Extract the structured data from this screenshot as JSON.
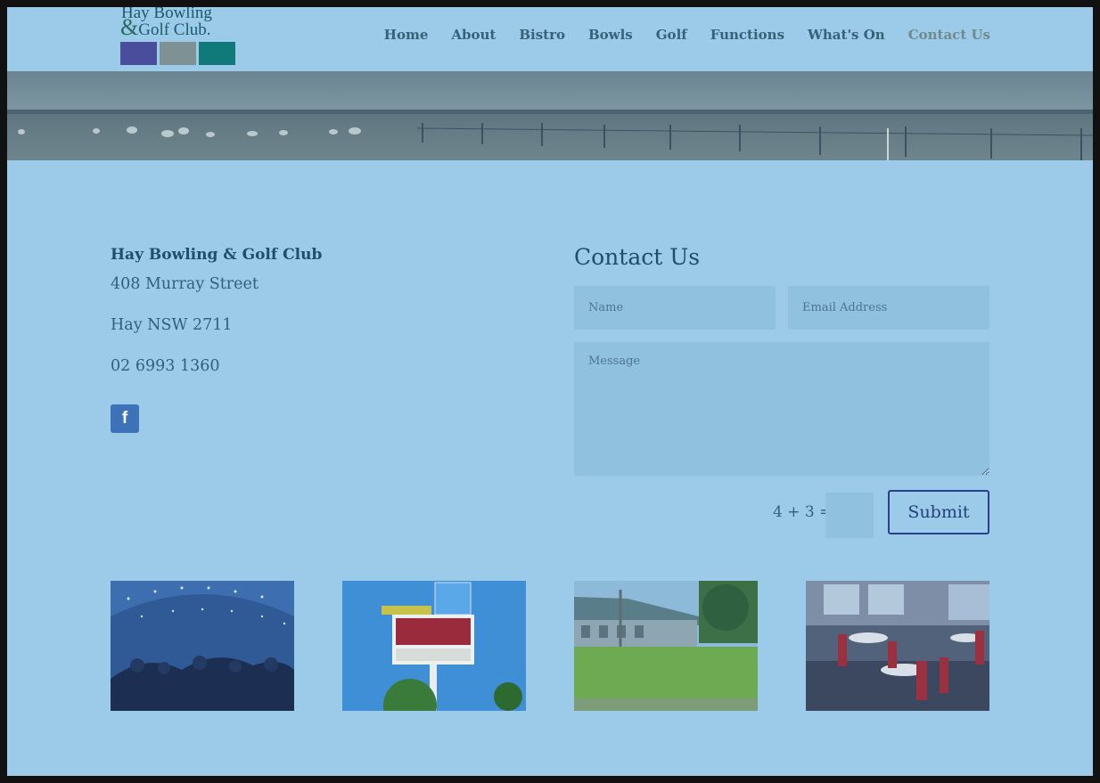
{
  "header": {
    "logo_line1": "Hay Bowling",
    "logo_amp": "&",
    "logo_line2": "Golf Club.",
    "logo_colors": [
      "#4a4c9c",
      "#7e9294",
      "#107a7a"
    ],
    "nav": [
      "Home",
      "About",
      "Bistro",
      "Bowls",
      "Golf",
      "Functions",
      "What's On",
      "Contact Us"
    ],
    "active_nav": "Contact Us"
  },
  "contact": {
    "club_name": "Hay Bowling & Golf Club",
    "street": "408 Murray Street",
    "town": "Hay NSW 2711",
    "phone": "02 6993 1360",
    "facebook_icon": "facebook-icon"
  },
  "form": {
    "title": "Contact Us",
    "name_placeholder": "Name",
    "email_placeholder": "Email Address",
    "message_placeholder": "Message",
    "captcha_question": "4 + 3 =",
    "submit_label": "Submit"
  },
  "colors": {
    "background": "#9bcbe8",
    "heading": "#1f4e6a",
    "submit_border": "#2e3f8a",
    "facebook": "#3e72b8"
  }
}
